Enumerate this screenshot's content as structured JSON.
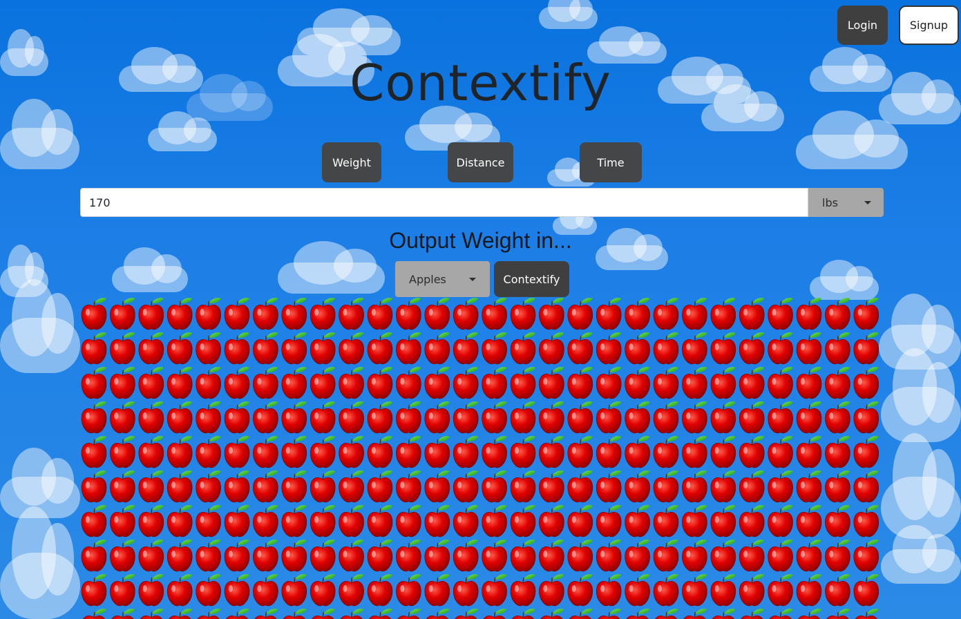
{
  "header": {
    "login_label": "Login",
    "signup_label": "Signup",
    "title": "Contextify"
  },
  "categories": {
    "weight_label": "Weight",
    "distance_label": "Distance",
    "time_label": "Time"
  },
  "input": {
    "value": "170",
    "unit": "lbs"
  },
  "output": {
    "heading": "Output Weight in...",
    "selected_unit": "Apples",
    "contextify_label": "Contextify"
  },
  "results": {
    "icon": "apple-icon",
    "apples_per_row": 28,
    "visible_rows": 10
  },
  "colors": {
    "sky": "#0a72de",
    "button_dark": "#3f3f3f",
    "select_gray": "#a7a7a7",
    "apple_red": "#d40000",
    "leaf_green": "#2fbf1f"
  }
}
